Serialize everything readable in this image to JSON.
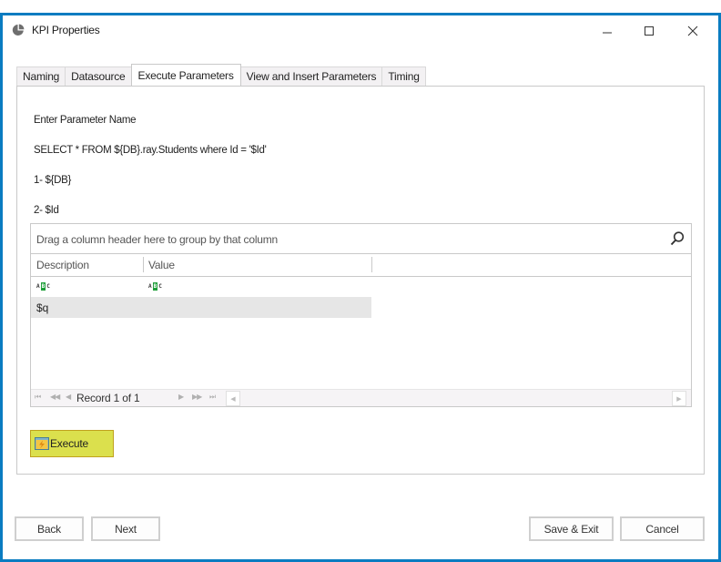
{
  "window": {
    "title": "KPI Properties",
    "controls": {
      "minimize": "—",
      "maximize": "☐",
      "close": "✕"
    },
    "accent_color": "#0a7cc1"
  },
  "tabs": [
    {
      "label": "Naming",
      "active": false
    },
    {
      "label": "Datasource",
      "active": false
    },
    {
      "label": "Execute Parameters",
      "active": true
    },
    {
      "label": "View and Insert Parameters",
      "active": false
    },
    {
      "label": "Timing",
      "active": false
    }
  ],
  "info_lines": [
    "Enter Parameter Name",
    "SELECT * FROM ${DB}.ray.Students where Id = '$Id'",
    "1- ${DB}",
    "2- $Id"
  ],
  "grid": {
    "group_panel_text": "Drag a column header here to group by that column",
    "columns": [
      "Description",
      "Value"
    ],
    "rows": [
      {
        "description": "$q",
        "value": ""
      }
    ],
    "navigator": {
      "first": "⏮",
      "prev_page": "◀◀",
      "prev": "◀",
      "record_text": "Record 1 of 1",
      "next": "▶",
      "next_page": "▶▶",
      "last": "⏭"
    }
  },
  "execute_button": {
    "label": "Execute",
    "highlight_color": "#dbe04d"
  },
  "footer": {
    "back": "Back",
    "next": "Next",
    "save_exit": "Save & Exit",
    "cancel": "Cancel"
  }
}
